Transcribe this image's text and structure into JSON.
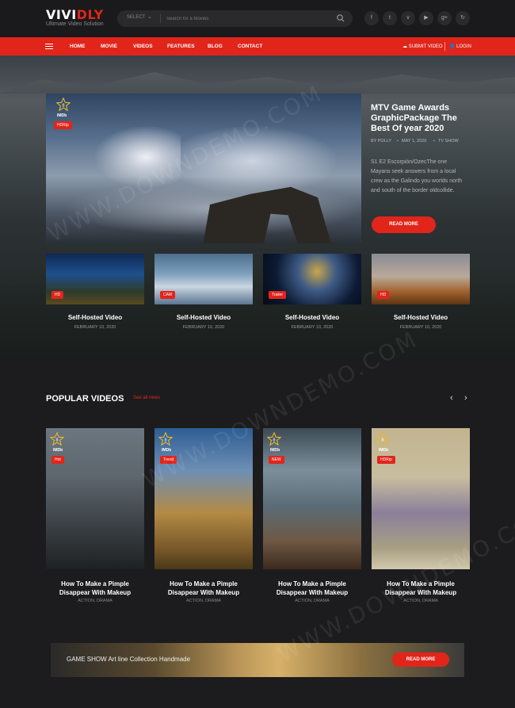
{
  "brand": {
    "logo_main": "VIVI",
    "logo_accent": "DLY",
    "tagline": "Ultimate Video Solution"
  },
  "search": {
    "select_label": "SELECT",
    "placeholder": "Search for a Movies"
  },
  "social_icons": [
    "facebook-icon",
    "twitter-icon",
    "vimeo-icon",
    "youtube-icon",
    "google-plus-icon",
    "share-icon"
  ],
  "social_glyphs": [
    "f",
    "t",
    "v",
    "▶",
    "g+",
    "↻"
  ],
  "nav": {
    "items": [
      "HOME",
      "MOVIE",
      "VIDEOS",
      "FEATURES",
      "BLOG",
      "CONTACT"
    ],
    "submit": "SUBMIT VIDEO",
    "login": "LOGIN"
  },
  "featured": {
    "badge_number": "8",
    "imdb": "IMDb",
    "quality": "HDRip",
    "title": "MTV Game Awards GraphicPackage The Best Of year 2020",
    "author": "BY POLLY",
    "date": "MAY 1, 2020",
    "category": "TV SHOW",
    "description": "S1 E2 Escorpión/OzecThe one Mayans seek answers from a local crew as the Galindo you worlds north and south of the border oldcollide.",
    "button": "READ MORE"
  },
  "hero_videos": [
    {
      "tag": "HD",
      "title": "Self-Hosted Video",
      "date": "FEBRUARY 10, 2020"
    },
    {
      "tag": "CAM",
      "title": "Self-Hosted Video",
      "date": "FEBRUARY 10, 2020"
    },
    {
      "tag": "Trailer",
      "title": "Self-Hosted Video",
      "date": "FEBRUARY 10, 2020"
    },
    {
      "tag": "HD",
      "title": "Self-Hosted Video",
      "date": "FEBRUARY 10, 2020"
    }
  ],
  "popular": {
    "title": "POPULAR VIDEOS",
    "see_all": "See all news",
    "prev": "‹",
    "next": "›",
    "items": [
      {
        "badge": "8",
        "imdb": "IMDb",
        "tag": "Hot",
        "title": "How To Make a Pimple Disappear With Makeup",
        "genre": "ACTION, DRAMA"
      },
      {
        "badge": "8",
        "imdb": "IMDb",
        "tag": "Trend",
        "title": "How To Make a Pimple Disappear With Makeup",
        "genre": "ACTION, DRAMA"
      },
      {
        "badge": "8",
        "imdb": "IMDb",
        "tag": "NEW",
        "title": "How To Make a Pimple Disappear With Makeup",
        "genre": "ACTION, DRAMA"
      },
      {
        "badge": "8",
        "imdb": "IMDb",
        "tag": "HDRip",
        "title": "How To Make a Pimple Disappear With Makeup",
        "genre": "ACTION, DRAMA"
      }
    ]
  },
  "banner": {
    "text": "GAME SHOW Art line Collection Handmade",
    "button": "READ MORE"
  },
  "watermark": "WWW.DOWNDEMO.COM",
  "colors": {
    "accent": "#e1251b",
    "background": "#1c1c1e"
  }
}
